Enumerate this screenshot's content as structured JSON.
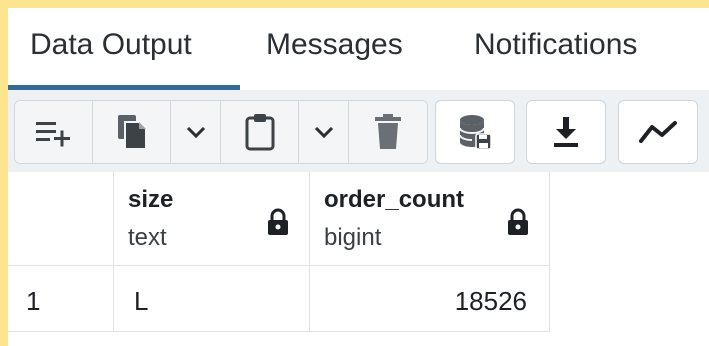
{
  "tabs": [
    {
      "label": "Data Output",
      "active": true
    },
    {
      "label": "Messages",
      "active": false
    },
    {
      "label": "Notifications",
      "active": false
    }
  ],
  "toolbar": {
    "icons": [
      "add-row-icon",
      "copy-icon",
      "chevron-down-icon",
      "paste-icon",
      "chevron-down-icon",
      "delete-icon",
      "save-data-icon",
      "download-icon",
      "graph-icon"
    ]
  },
  "grid": {
    "columns": [
      {
        "name": "size",
        "type": "text"
      },
      {
        "name": "order_count",
        "type": "bigint"
      }
    ],
    "rows": [
      {
        "number": "1",
        "size": "L",
        "order_count": "18526"
      }
    ]
  },
  "colors": {
    "frame": "#fde58f",
    "active_tab_underline": "#346a96",
    "toolbar_bg": "#eef1f4"
  }
}
